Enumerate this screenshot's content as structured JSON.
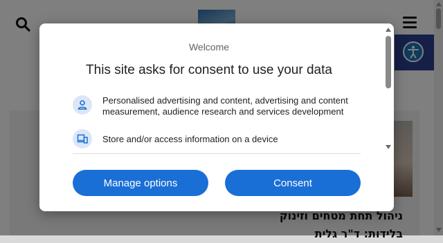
{
  "page": {
    "article_title": "ניהול תחת מטחים וזינוק בלידות: ד\"ר גלית"
  },
  "consent_dialog": {
    "header": "Welcome",
    "title": "This site asks for consent to use your data",
    "purposes": [
      {
        "icon": "person-icon",
        "text": "Personalised advertising and content, advertising and content measurement, audience research and services development"
      },
      {
        "icon": "devices-icon",
        "text": "Store and/or access information on a device"
      }
    ],
    "buttons": {
      "manage": "Manage options",
      "consent": "Consent"
    }
  },
  "colors": {
    "button": "#1a6fd6",
    "icon_bg": "#dbe7f7",
    "accessibility": "#1b75bc"
  }
}
